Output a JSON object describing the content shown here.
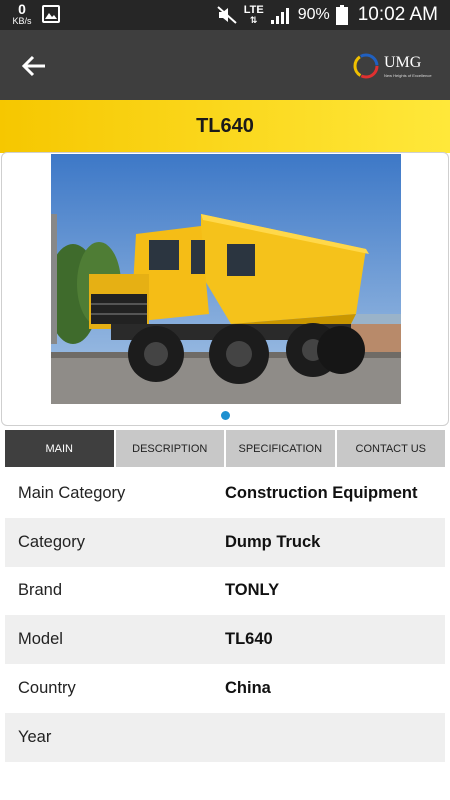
{
  "status_bar": {
    "data_rate": "0",
    "data_unit": "KB/s",
    "network": "LTE",
    "battery": "90%",
    "time": "10:02 AM"
  },
  "app_bar": {
    "back_icon": "arrow-left-icon",
    "logo_text": "UMG",
    "logo_tagline": "New Heights of Excellence"
  },
  "product": {
    "title": "TL640"
  },
  "gallery": {
    "image": "yellow-dump-truck",
    "page_count": 1,
    "active_index": 0
  },
  "tabs": [
    {
      "label": "MAIN",
      "active": true
    },
    {
      "label": "DESCRIPTION",
      "active": false
    },
    {
      "label": "SPECIFICATION",
      "active": false
    },
    {
      "label": "CONTACT US",
      "active": false
    }
  ],
  "details": [
    {
      "label": "Main Category",
      "value": "Construction Equipment"
    },
    {
      "label": "Category",
      "value": "Dump Truck"
    },
    {
      "label": "Brand",
      "value": "TONLY"
    },
    {
      "label": "Model",
      "value": "TL640"
    },
    {
      "label": "Country",
      "value": "China"
    },
    {
      "label": "Year",
      "value": ""
    }
  ],
  "colors": {
    "status_bar": "#262626",
    "app_bar": "#3e3e3e",
    "title_band": "#ffd600",
    "tab_active": "#3f3f3f",
    "tab_inactive": "#c8c8c8",
    "pager_dot": "#1e90d0"
  }
}
